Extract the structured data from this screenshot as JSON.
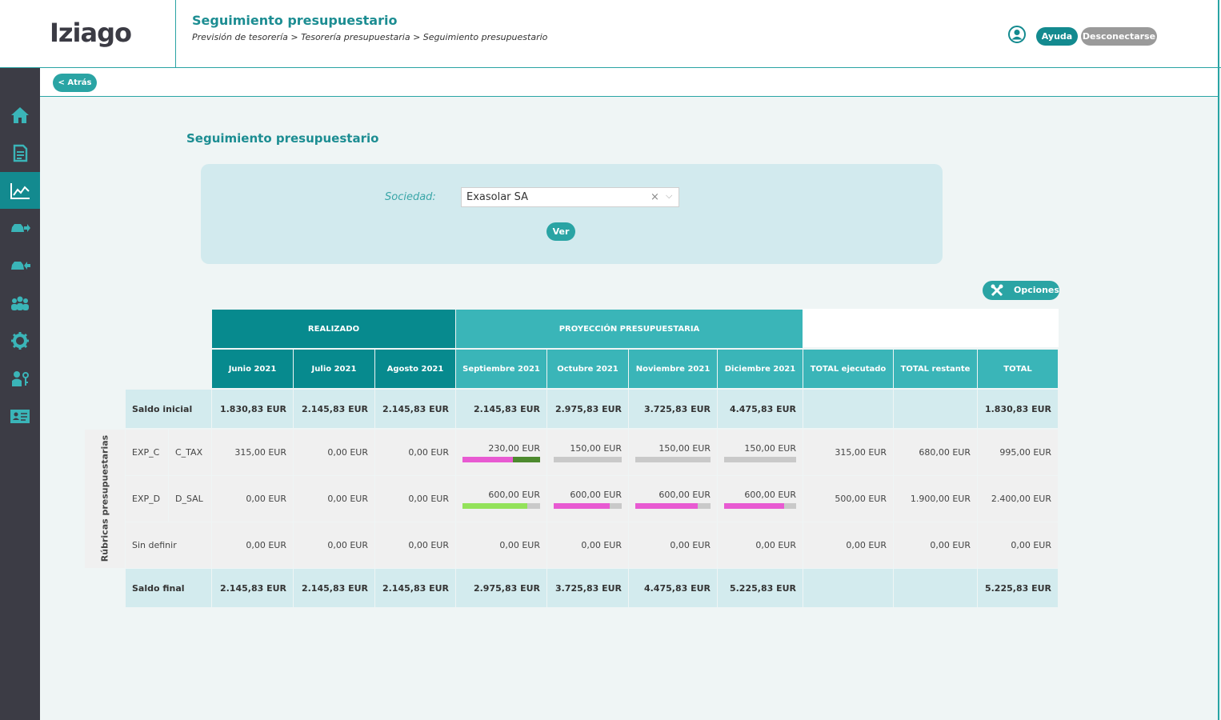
{
  "header": {
    "logo": "Iziago",
    "title": "Seguimiento presupuestario",
    "breadcrumb": "Previsión de tesorería > Tesorería presupuestaria > Seguimiento presupuestario",
    "help_label": "Ayuda",
    "logout_label": "Desconectarse"
  },
  "sidebar": {
    "items": [
      "home-icon",
      "document-icon",
      "chart-icon",
      "car-out-icon",
      "car-in-icon",
      "users-icon",
      "gear-icon",
      "user-key-icon",
      "id-card-icon"
    ],
    "active_index": 2
  },
  "subbar": {
    "back_label": "< Atrás"
  },
  "section_title": "Seguimiento presupuestario",
  "filter": {
    "label": "Sociedad:",
    "value": "Exasolar SA",
    "clear_symbol": "×",
    "arrow_symbol": "⌵",
    "submit_label": "Ver"
  },
  "options_label": "Opciones",
  "table": {
    "group_realizado": "REALIZADO",
    "group_proyeccion": "PROYECCIÓN PRESUPUESTARIA",
    "columns": [
      "Junio 2021",
      "Julio 2021",
      "Agosto 2021",
      "Septiembre 2021",
      "Octubre 2021",
      "Noviembre 2021",
      "Diciembre 2021",
      "TOTAL ejecutado",
      "TOTAL restante",
      "TOTAL"
    ],
    "side_label": "Rúbricas presupuestarias",
    "saldo_inicial": {
      "label": "Saldo inicial",
      "values": [
        "1.830,83 EUR",
        "2.145,83 EUR",
        "2.145,83 EUR",
        "2.145,83 EUR",
        "2.975,83 EUR",
        "3.725,83 EUR",
        "4.475,83 EUR",
        "",
        "",
        "1.830,83 EUR"
      ]
    },
    "rows": [
      {
        "code": "EXP_C",
        "sub": "C_TAX",
        "values": [
          "315,00 EUR",
          "0,00 EUR",
          "0,00 EUR",
          "230,00 EUR",
          "150,00 EUR",
          "150,00 EUR",
          "150,00 EUR",
          "315,00 EUR",
          "680,00 EUR",
          "995,00 EUR"
        ],
        "bars": [
          {
            "fill": 0.65,
            "color": "#e85ad2",
            "fill2": 0.35,
            "color2": "#4d8a2e"
          },
          {
            "fill": 0,
            "color": "#e85ad2"
          },
          {
            "fill": 0,
            "color": "#e85ad2"
          },
          {
            "fill": 0,
            "color": "#e85ad2"
          }
        ]
      },
      {
        "code": "EXP_D",
        "sub": "D_SAL",
        "values": [
          "0,00 EUR",
          "0,00 EUR",
          "0,00 EUR",
          "600,00 EUR",
          "600,00 EUR",
          "600,00 EUR",
          "600,00 EUR",
          "500,00 EUR",
          "1.900,00 EUR",
          "2.400,00 EUR"
        ],
        "bars": [
          {
            "fill": 0.84,
            "color": "#93e25a"
          },
          {
            "fill": 0.82,
            "color": "#e85ad2"
          },
          {
            "fill": 0.83,
            "color": "#e85ad2"
          },
          {
            "fill": 0.83,
            "color": "#e85ad2"
          }
        ]
      },
      {
        "code": "Sin definir",
        "sub": "",
        "values": [
          "0,00 EUR",
          "0,00 EUR",
          "0,00 EUR",
          "0,00 EUR",
          "0,00 EUR",
          "0,00 EUR",
          "0,00 EUR",
          "0,00 EUR",
          "0,00 EUR",
          "0,00 EUR"
        ],
        "bars": []
      }
    ],
    "saldo_final": {
      "label": "Saldo final",
      "values": [
        "2.145,83 EUR",
        "2.145,83 EUR",
        "2.145,83 EUR",
        "2.975,83 EUR",
        "3.725,83 EUR",
        "4.475,83 EUR",
        "5.225,83 EUR",
        "",
        "",
        "5.225,83 EUR"
      ]
    }
  }
}
